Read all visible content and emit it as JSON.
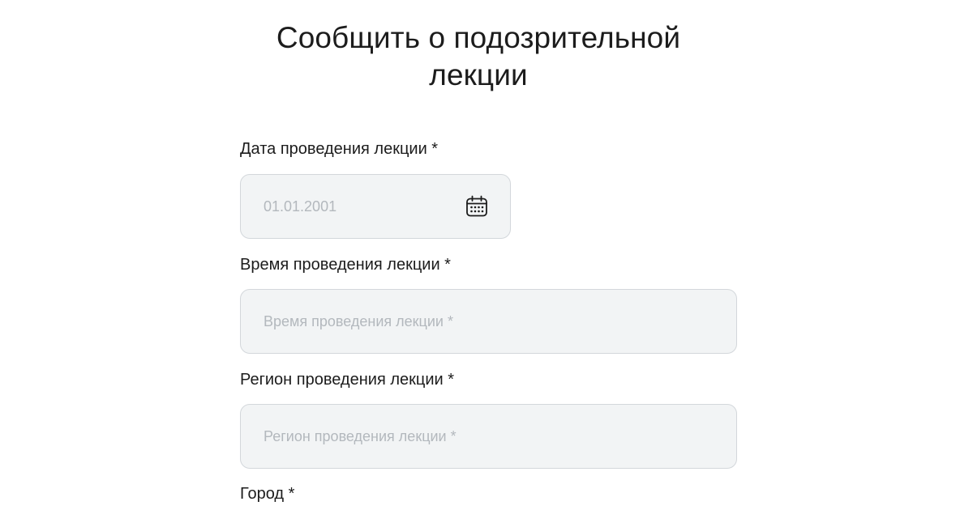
{
  "title": "Сообщить о подозрительной лекции",
  "fields": {
    "date": {
      "label": "Дата проведения лекции *",
      "placeholder": "01.01.2001",
      "value": "",
      "icon": "calendar-icon"
    },
    "time": {
      "label": "Время проведения лекции *",
      "placeholder": "Время проведения лекции *",
      "value": ""
    },
    "region": {
      "label": "Регион проведения лекции *",
      "placeholder": "Регион проведения лекции *",
      "value": ""
    },
    "city": {
      "label": "Город *"
    }
  },
  "colors": {
    "text": "#1c1c1c",
    "input_bg": "#f2f4f5",
    "input_border": "#d3d7db",
    "placeholder": "#b3b8bd"
  }
}
